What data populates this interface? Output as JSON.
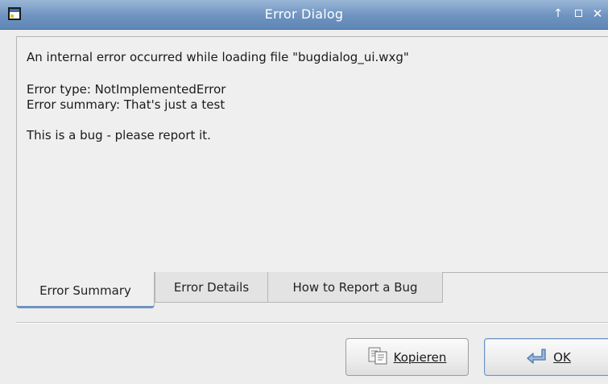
{
  "window": {
    "title": "Error Dialog",
    "titlebar_color": "#6e93c0"
  },
  "icons": {
    "app": "dialog-app-icon",
    "shade": "shade-up-icon",
    "maximize": "maximize-icon",
    "close": "close-icon",
    "copy": "copy-clipboard-icon",
    "ok": "return-arrow-icon"
  },
  "titlebar_buttons": {
    "shade": "↑",
    "close": "✕"
  },
  "messages": {
    "line1": "An internal error occurred while loading file \"bugdialog_ui.wxg\"",
    "line2": "Error type: NotImplementedError",
    "line3": "Error summary: That's just a test",
    "line4": "This is a bug - please report it."
  },
  "tabs": [
    {
      "label": "Error Summary",
      "active": true
    },
    {
      "label": "Error Details",
      "active": false
    },
    {
      "label": "How to Report a Bug",
      "active": false
    }
  ],
  "buttons": {
    "copy_label": "Kopieren",
    "ok_label": "OK"
  },
  "accent_color": "#6f94c3"
}
